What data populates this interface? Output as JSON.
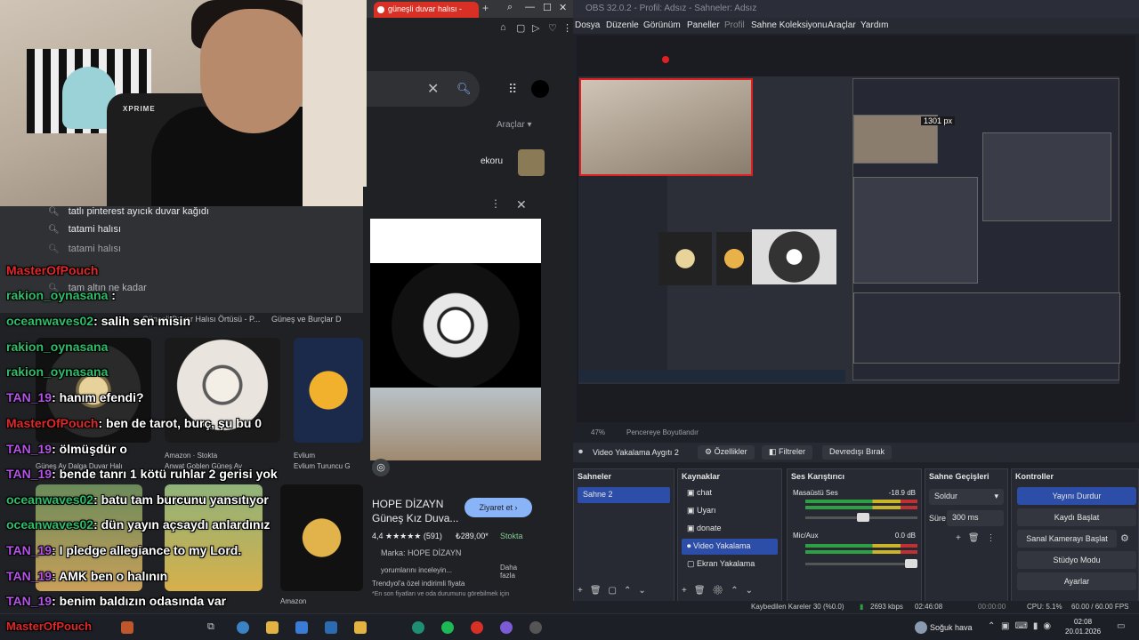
{
  "browser": {
    "tab_title": "güneşli duvar halısı - ",
    "tools_label": "Araçlar",
    "chip_label": "ekoru"
  },
  "suggestions": [
    "tatlı pinterest ayıcık duvar kağıdı",
    "tatami halısı",
    "tatami halısı",
    "tam altın ne kadar"
  ],
  "chat": [
    {
      "user": "MasterOfPouch",
      "msg": "",
      "color": "#e0282a"
    },
    {
      "user": "rakion_oynasana",
      "msg": "",
      "color": "#2fbd6b"
    },
    {
      "user": "oceanwaves02",
      "msg": ": salih sen misin",
      "color": "#2fbd6b"
    },
    {
      "user": "rakion_oynasana",
      "msg": "",
      "color": "#2fbd6b"
    },
    {
      "user": "rakion_oynasana",
      "msg": "",
      "color": "#2fbd6b"
    },
    {
      "user": "TAN_19",
      "msg": ": hanım efendi?",
      "color": "#b455e6"
    },
    {
      "user": "MasterOfPouch",
      "msg": ": ben de tarot, burç, şu bu 0",
      "color": "#e0282a"
    },
    {
      "user": "TAN_19",
      "msg": ": ölmüşdür o",
      "color": "#b455e6"
    },
    {
      "user": "TAN_19",
      "msg": ": bende tanrı 1 kötü ruhlar 2 gerisi yok",
      "color": "#b455e6"
    },
    {
      "user": "oceanwaves02",
      "msg": ": batu tam burcunu yansıtıyor",
      "color": "#2fbd6b"
    },
    {
      "user": "oceanwaves02",
      "msg": ": dün yayın açsaydı anlardınız",
      "color": "#2fbd6b"
    },
    {
      "user": "TAN_19",
      "msg": ": I pledge allegiance to my Lord.",
      "color": "#b455e6"
    },
    {
      "user": "TAN_19",
      "msg": ": AMK ben o halının",
      "color": "#b455e6"
    },
    {
      "user": "TAN_19",
      "msg": ": benim baldızın odasında var",
      "color": "#b455e6"
    },
    {
      "user": "MasterOfPouch",
      "msg": "",
      "color": "#e0282a"
    }
  ],
  "grid": {
    "captions": [
      "Güneş ve Burçlar D",
      "Amazon · Stokta",
      "Amazon",
      "Evlium Turuncu G",
      "Evlium",
      "Güneş Ay Dalga Duvar Halı",
      "Anwat Goblen Güneş Ay"
    ],
    "caption_left": "Güneşli Duvar Halısı Örtüsü - P..."
  },
  "product": {
    "brand": "HOPE DİZAYN",
    "title": "Güneş Kız Duva...",
    "rating": "4,4 ★★★★★ (591)",
    "price": "₺289,00*",
    "stock": "Stokta",
    "brand_line": "Marka: HOPE DİZAYN",
    "reviews": "yorumlarını inceleyin...",
    "more": "Daha fazla",
    "discount": "Trendyol'a özel indirimli fiyata",
    "note": "*En son fiyatları ve oda durumunu görebilmek için",
    "visit": "Ziyaret et"
  },
  "obs": {
    "title": "OBS 32.0.2 - Profil: Adsız - Sahneler: Adsız",
    "menu": [
      "Dosya",
      "Düzenle",
      "Görünüm",
      "Paneller",
      "Profil",
      "Sahne Koleksiyonu",
      "Araçlar",
      "Yardım"
    ],
    "size_label": "1301 px",
    "preview_zoom": "47%",
    "fit_label": "Pencereye Boyutlandır",
    "source_name": "Video Yakalama Aygıtı 2",
    "props": "Özellikler",
    "filters": "Filtreler",
    "deactivate": "Devredışı Bırak",
    "scenes_title": "Sahneler",
    "scenes": [
      "Sahne 2"
    ],
    "sources_title": "Kaynaklar",
    "sources": [
      "chat",
      "Uyarı",
      "donate",
      "Video Yakalama",
      "Ekran Yakalama"
    ],
    "mixer_title": "Ses Karıştırıcı",
    "mixer": [
      {
        "name": "Masaüstü Ses",
        "db": "-18.9 dB"
      },
      {
        "name": "Mic/Aux",
        "db": "0.0 dB"
      }
    ],
    "transitions_title": "Sahne Geçişleri",
    "transition": "Soldur",
    "duration_label": "Süre",
    "duration": "300 ms",
    "controls_title": "Kontroller",
    "controls": [
      "Yayını Durdur",
      "Kaydı Başlat",
      "Sanal Kamerayı Başlat",
      "Stüdyo Modu",
      "Ayarlar"
    ],
    "status": {
      "dropped": "Kaybedilen Kareler 30 (%0.0)",
      "bitrate": "2693 kbps",
      "live_time": "02:46:08",
      "rec_time": "00:00:00",
      "cpu": "CPU: 5.1%",
      "fps": "60.00 / 60.00 FPS"
    }
  },
  "taskbar": {
    "weather": "Soğuk hava",
    "time": "02:08",
    "date": "20.01.2026",
    "overlay_user": "MasterOfPouch"
  }
}
